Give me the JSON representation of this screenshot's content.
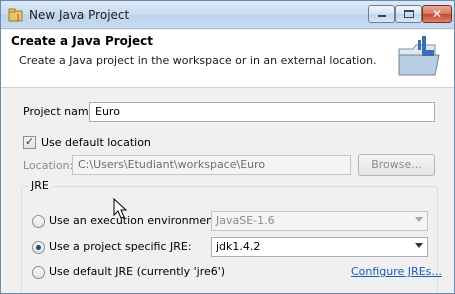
{
  "window": {
    "title": "New Java Project"
  },
  "banner": {
    "title": "Create a Java Project",
    "description": "Create a Java project in the workspace or in an external location."
  },
  "project": {
    "name_label": "Project name:",
    "name_value": "Euro",
    "use_default_location_label": "Use default location",
    "use_default_location_checked": true,
    "location_label": "Location:",
    "location_value": "C:\\Users\\Etudiant\\workspace\\Euro",
    "browse_label": "Browse..."
  },
  "jre": {
    "group_label": "JRE",
    "options": [
      {
        "label": "Use an execution environment JRE:",
        "selected": false,
        "value": "JavaSE-1.6",
        "enabled": false
      },
      {
        "label": "Use a project specific JRE:",
        "selected": true,
        "value": "jdk1.4.2",
        "enabled": true
      },
      {
        "label": "Use default JRE (currently 'jre6')",
        "selected": false
      }
    ],
    "configure_link": "Configure JREs..."
  },
  "colors": {
    "link": "#1a5eb5",
    "titlebar": "#c9dcf1",
    "close_button": "#c34a30"
  }
}
